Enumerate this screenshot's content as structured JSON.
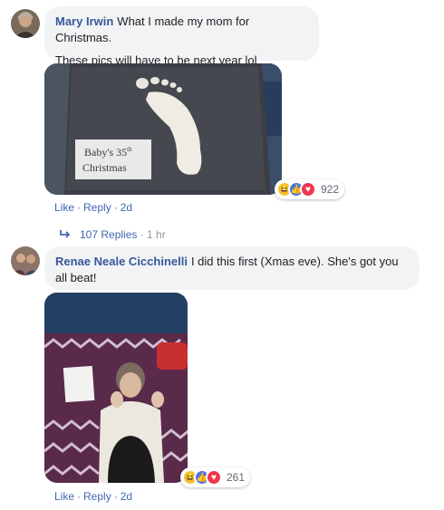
{
  "comments": [
    {
      "author": "Mary Irwin",
      "text_line1": "What I made my mom for Christmas.",
      "text_line2": "These pics will have to be next year lol",
      "photo_caption_line1": "Baby's 35",
      "photo_caption_sup": "th",
      "photo_caption_line2": "Christmas",
      "reaction_count": "922",
      "like_label": "Like",
      "reply_label": "Reply",
      "time": "2d",
      "replies_label": "107 Replies",
      "replies_time": "1 hr"
    },
    {
      "author": "Renae Neale Cicchinelli",
      "text_line1": "I did this first (Xmas eve). She's got you",
      "text_line2": "all beat!",
      "reaction_count": "261",
      "like_label": "Like",
      "reply_label": "Reply",
      "time": "2d"
    }
  ],
  "colors": {
    "author": "#385898",
    "link": "#4267b2",
    "bubble": "#f2f3f5"
  }
}
